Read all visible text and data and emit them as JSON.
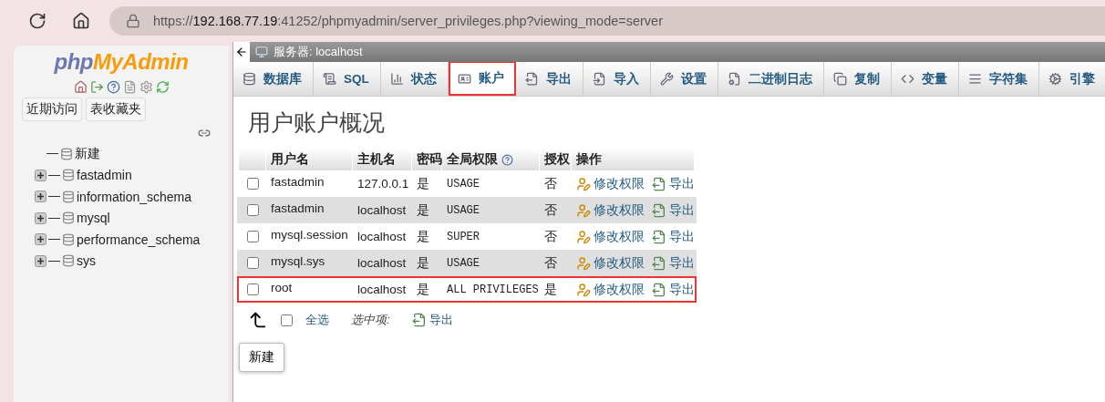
{
  "browser": {
    "url_parts": [
      {
        "text": "https://",
        "emphasis": false
      },
      {
        "text": "192.168.77.19",
        "emphasis": true
      },
      {
        "text": ":41252/phpmyadmin/server_privileges.php?viewing_mode=server",
        "emphasis": false
      }
    ]
  },
  "sidebar": {
    "logo": {
      "part1": "php",
      "part2": "MyAdmin"
    },
    "buttons": [
      "近期访问",
      "表收藏夹"
    ],
    "tree": [
      {
        "label": "新建",
        "kind": "new"
      },
      {
        "label": "fastadmin",
        "kind": "db",
        "expanded": false
      },
      {
        "label": "information_schema",
        "kind": "db",
        "expanded": false
      },
      {
        "label": "mysql",
        "kind": "db",
        "expanded": false
      },
      {
        "label": "performance_schema",
        "kind": "db",
        "expanded": false
      },
      {
        "label": "sys",
        "kind": "db",
        "expanded": false
      }
    ]
  },
  "main": {
    "breadcrumb": "服务器: localhost",
    "tabs": [
      {
        "label": "数据库",
        "selected": false,
        "highlighted": false
      },
      {
        "label": "SQL",
        "selected": false,
        "highlighted": false
      },
      {
        "label": "状态",
        "selected": false,
        "highlighted": false
      },
      {
        "label": "账户",
        "selected": true,
        "highlighted": true
      },
      {
        "label": "导出",
        "selected": false,
        "highlighted": false
      },
      {
        "label": "导入",
        "selected": false,
        "highlighted": false
      },
      {
        "label": "设置",
        "selected": false,
        "highlighted": false
      },
      {
        "label": "二进制日志",
        "selected": false,
        "highlighted": false
      },
      {
        "label": "复制",
        "selected": false,
        "highlighted": false
      },
      {
        "label": "变量",
        "selected": false,
        "highlighted": false
      },
      {
        "label": "字符集",
        "selected": false,
        "highlighted": false
      },
      {
        "label": "引擎",
        "selected": false,
        "highlighted": false
      }
    ],
    "heading": "用户账户概况",
    "table": {
      "columns": [
        "用户名",
        "主机名",
        "密码",
        "全局权限",
        "授权",
        "操作"
      ],
      "rows": [
        {
          "user": "fastadmin",
          "host": "127.0.0.1",
          "password": "是",
          "privileges": "USAGE",
          "grant": "否",
          "edit": "修改权限",
          "export": "导出",
          "checked": false,
          "highlighted": false
        },
        {
          "user": "fastadmin",
          "host": "localhost",
          "password": "是",
          "privileges": "USAGE",
          "grant": "否",
          "edit": "修改权限",
          "export": "导出",
          "checked": false,
          "highlighted": false
        },
        {
          "user": "mysql.session",
          "host": "localhost",
          "password": "是",
          "privileges": "SUPER",
          "grant": "否",
          "edit": "修改权限",
          "export": "导出",
          "checked": false,
          "highlighted": false
        },
        {
          "user": "mysql.sys",
          "host": "localhost",
          "password": "是",
          "privileges": "USAGE",
          "grant": "否",
          "edit": "修改权限",
          "export": "导出",
          "checked": false,
          "highlighted": false
        },
        {
          "user": "root",
          "host": "localhost",
          "password": "是",
          "privileges": "ALL PRIVILEGES",
          "grant": "是",
          "edit": "修改权限",
          "export": "导出",
          "checked": false,
          "highlighted": true
        }
      ]
    },
    "footer": {
      "select_all": "全选",
      "select_all_checked": false,
      "with_selected": "选中项:",
      "export": "导出"
    },
    "new_button": "新建"
  }
}
